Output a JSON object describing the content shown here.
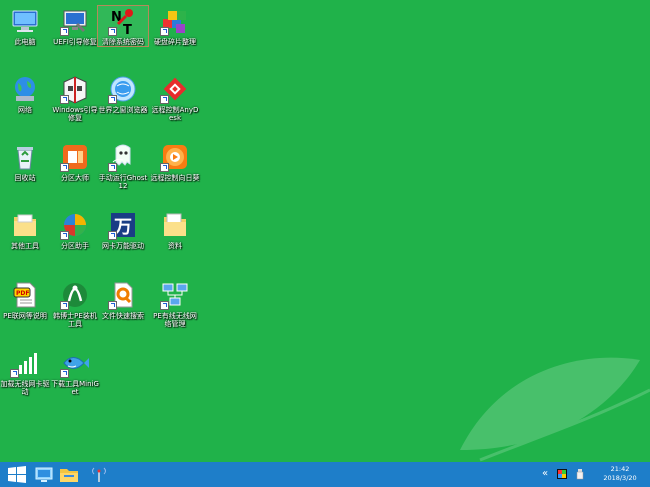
{
  "desktop": {
    "background_color": "#20b24a",
    "icons": [
      {
        "label": "此电脑",
        "icon": "computer-icon",
        "shortcut": false
      },
      {
        "label": "UEFI引导修复",
        "icon": "monitor-repair-icon",
        "shortcut": true
      },
      {
        "label": "清除系统密码",
        "icon": "nt-password-icon",
        "shortcut": true,
        "selected": true
      },
      {
        "label": "硬盘碎片整理",
        "icon": "defrag-cubes-icon",
        "shortcut": true
      },
      {
        "label": "网络",
        "icon": "network-globe-icon",
        "shortcut": false
      },
      {
        "label": "Windows引导修复",
        "icon": "boot-repair-icon",
        "shortcut": true
      },
      {
        "label": "世界之窗浏览器",
        "icon": "browser-globe-icon",
        "shortcut": true
      },
      {
        "label": "远程控制AnyDesk",
        "icon": "anydesk-icon",
        "shortcut": true
      },
      {
        "label": "回收站",
        "icon": "recycle-bin-icon",
        "shortcut": false
      },
      {
        "label": "分区大师",
        "icon": "partition-master-icon",
        "shortcut": true
      },
      {
        "label": "手动运行Ghost12",
        "icon": "ghost-icon",
        "shortcut": true
      },
      {
        "label": "远程控制向日葵",
        "icon": "sunflower-icon",
        "shortcut": true
      },
      {
        "label": "其他工具",
        "icon": "folder-icon",
        "shortcut": false
      },
      {
        "label": "分区助手",
        "icon": "partition-assistant-icon",
        "shortcut": true
      },
      {
        "label": "网卡万能驱动",
        "icon": "wan-driver-icon",
        "shortcut": true
      },
      {
        "label": "资料",
        "icon": "folder-docs-icon",
        "shortcut": false
      },
      {
        "label": "PE联网等说明",
        "icon": "pdf-doc-icon",
        "shortcut": false
      },
      {
        "label": "韩博士PE装机工具",
        "icon": "installer-tool-icon",
        "shortcut": true
      },
      {
        "label": "文件快速搜索",
        "icon": "file-search-icon",
        "shortcut": true
      },
      {
        "label": "PE有线无线网络管理",
        "icon": "network-manager-icon",
        "shortcut": true
      },
      {
        "label": "加载无线网卡驱动",
        "icon": "wifi-signal-icon",
        "shortcut": true
      },
      {
        "label": "下载工具MiniGet",
        "icon": "fish-download-icon",
        "shortcut": true
      }
    ]
  },
  "taskbar": {
    "color": "#1e7ec9",
    "pinned": [
      {
        "name": "start-button",
        "icon": "windows-logo-icon"
      },
      {
        "name": "taskbar-desktop-button",
        "icon": "display-icon"
      },
      {
        "name": "taskbar-explorer-button",
        "icon": "folder-icon"
      },
      {
        "name": "taskbar-network-button",
        "icon": "antenna-icon"
      }
    ],
    "tray": {
      "expand_symbol": "«",
      "time": "21:42",
      "date": "2018/3/20"
    }
  }
}
